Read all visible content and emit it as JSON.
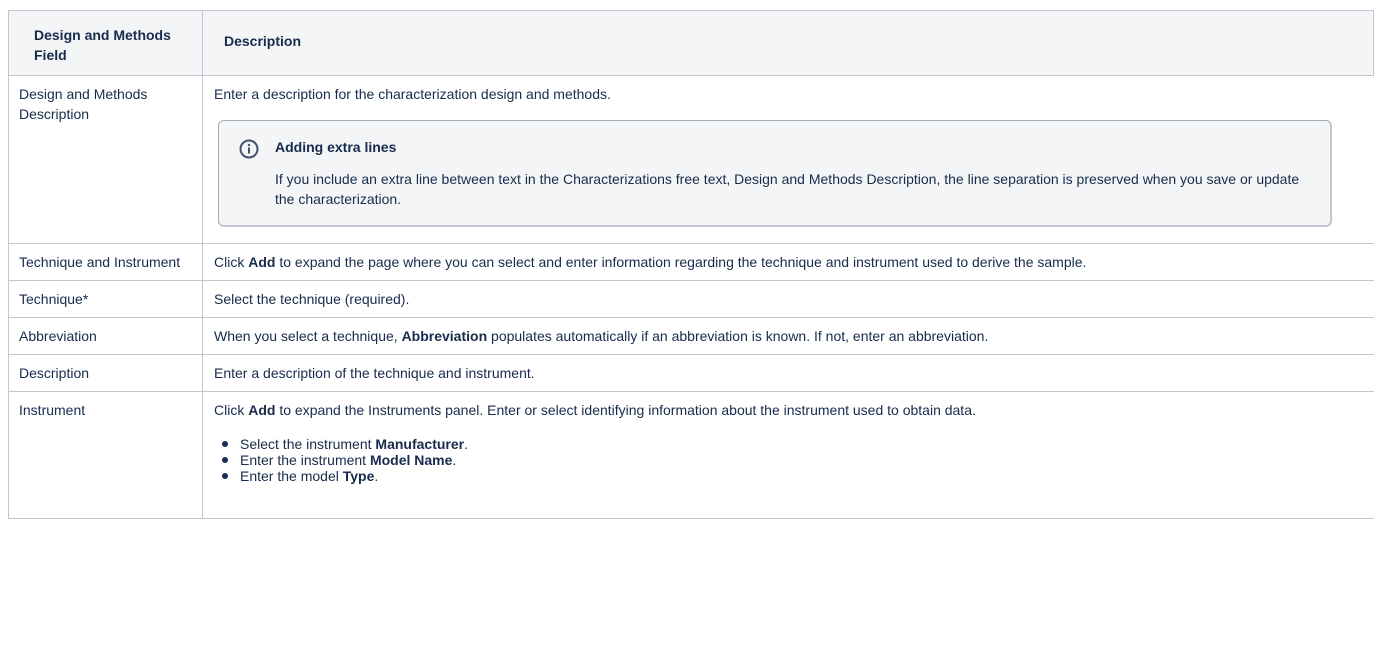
{
  "table": {
    "headers": [
      "Design and Methods Field",
      "Description"
    ],
    "rows": [
      {
        "field": "Design and Methods Description",
        "description": "Enter a description for the characterization design and methods.",
        "info": {
          "title": "Adding extra lines",
          "body": "If you include an extra line between text in the Characterizations free text, Design and Methods Description, the line separation is preserved when you save or update the characterization."
        }
      },
      {
        "field": "Technique and Instrument",
        "desc_before": "Click ",
        "desc_bold": "Add",
        "desc_after": " to expand the page where you can select and enter information regarding the technique and instrument used to derive the sample."
      },
      {
        "field": "Technique*",
        "description": "Select the technique (required)."
      },
      {
        "field": "Abbreviation",
        "desc_before": "When you select a technique, ",
        "desc_bold": "Abbreviation",
        "desc_after": " populates automatically if an abbreviation is known. If not, enter an abbreviation."
      },
      {
        "field": "Description",
        "description": "Enter a description of the technique and instrument."
      },
      {
        "field": "Instrument",
        "desc_before": "Click ",
        "desc_bold": "Add",
        "desc_after": " to expand the Instruments panel. Enter or select identifying information about the instrument used to obtain data.",
        "bullets": [
          {
            "before": "Select the instrument ",
            "bold": "Manufacturer",
            "after": "."
          },
          {
            "before": "Enter the instrument ",
            "bold": "Model Name",
            "after": "."
          },
          {
            "before": "Enter the model ",
            "bold": "Type",
            "after": "."
          }
        ]
      }
    ]
  },
  "icons": {
    "info": "info-icon"
  }
}
